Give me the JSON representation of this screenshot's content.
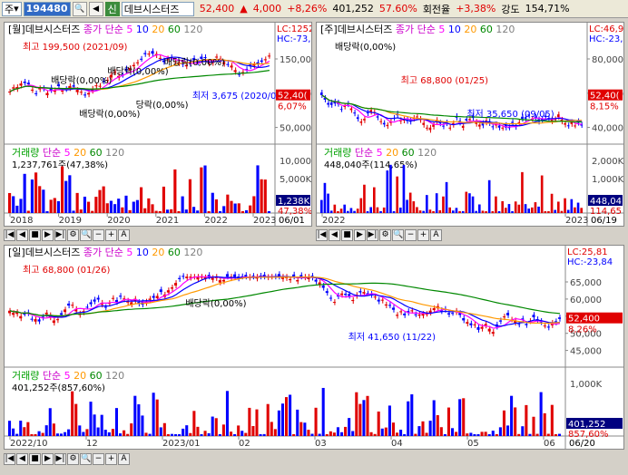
{
  "toolbar": {
    "market": "주",
    "code": "194480",
    "name": "데브시스터즈",
    "credit": "신",
    "price": "52,400",
    "change": "4,000",
    "rate": "+8,26%",
    "volume": "401,252",
    "turnover": "57.60%",
    "ratio_label": "회전율",
    "ratio": "+3,38%",
    "strength_label": "강도",
    "strength": "154,71%"
  },
  "colors": {
    "up": "#e00000",
    "down": "#0000ff",
    "ma5": "#ff00ff",
    "ma10": "#0000ff",
    "ma20": "#ff9900",
    "ma60": "#008800",
    "ma120": "#808080"
  },
  "panels": [
    {
      "id": "monthly",
      "header": "[월]데브시스터즈",
      "price_legend": "종가 단순",
      "legend_periods": [
        "5",
        "10",
        "20",
        "60",
        "120"
      ],
      "corner": [
        "LC:1252",
        "HC:-73,"
      ],
      "price_badge": "52,40(",
      "pct": "6,07%",
      "y_labels": [
        "150,000",
        "100,000",
        "50,000"
      ],
      "annotations": [
        "최고 199,500 (2021/09)",
        "배당락(0,00%)",
        "배당락(0,00%)",
        "배당락(0,00%)",
        "당락(0,00%)",
        "배당락(0,00%)",
        "최저 3,675 (2020/03)"
      ],
      "volume_title": "거래량",
      "volume_legend": "단순",
      "volume_periods": [
        "5",
        "20",
        "60",
        "120"
      ],
      "volume_value": "1,237,761주(47,38%)",
      "vol_y_labels": [
        "10,000K",
        "5,000K"
      ],
      "vol_badge": "1,238K",
      "vol_pct": "47,38%",
      "x_labels": [
        "2018",
        "2019",
        "2020",
        "2021",
        "2022",
        "2023"
      ],
      "date": "06/01"
    },
    {
      "id": "weekly",
      "header": "[주]데브시스터즈",
      "price_legend": "종가 단순",
      "legend_periods": [
        "5",
        "10",
        "20",
        "60",
        "120"
      ],
      "corner": [
        "LC:46,98",
        "HC:-23,6"
      ],
      "price_badge": "52,40(",
      "pct": "8,15%",
      "y_labels": [
        "80,000",
        "60,000",
        "40,000"
      ],
      "annotations": [
        "배당락(0,00%)",
        "최고 68,800 (01/25)",
        "최저 35,650 (09/05)"
      ],
      "volume_title": "거래량",
      "volume_legend": "단순",
      "volume_periods": [
        "5",
        "20",
        "60",
        "120"
      ],
      "volume_value": "448,040주(114,65%)",
      "vol_y_labels": [
        "2,000K",
        "1,000K"
      ],
      "vol_badge": "448,04",
      "vol_pct": "114,65",
      "x_labels": [
        "2022",
        "2023"
      ],
      "date": "06/19"
    },
    {
      "id": "daily",
      "header": "[일]데브시스터즈",
      "price_legend": "종가 단순",
      "legend_periods": [
        "5",
        "10",
        "20",
        "60",
        "120"
      ],
      "corner": [
        "LC:25,81",
        "HC:-23,84"
      ],
      "price_badge": "52,400",
      "pct": "8,26%",
      "y_labels": [
        "65,000",
        "60,000",
        "55,000",
        "50,000",
        "45,000"
      ],
      "annotations": [
        "최고 68,800 (01/26)",
        "배당락(0,00%)",
        "최저 41,650 (11/22)"
      ],
      "volume_title": "거래량",
      "volume_legend": "단순",
      "volume_periods": [
        "5",
        "20",
        "60",
        "120"
      ],
      "volume_value": "401,252주(857,60%)",
      "vol_y_labels": [
        "1,000K"
      ],
      "vol_badge": "401,252",
      "vol_pct": "857,60%",
      "x_labels": [
        "2022/10",
        "12",
        "2023/01",
        "02",
        "03",
        "04",
        "05",
        "06"
      ],
      "date": "06/20"
    }
  ]
}
